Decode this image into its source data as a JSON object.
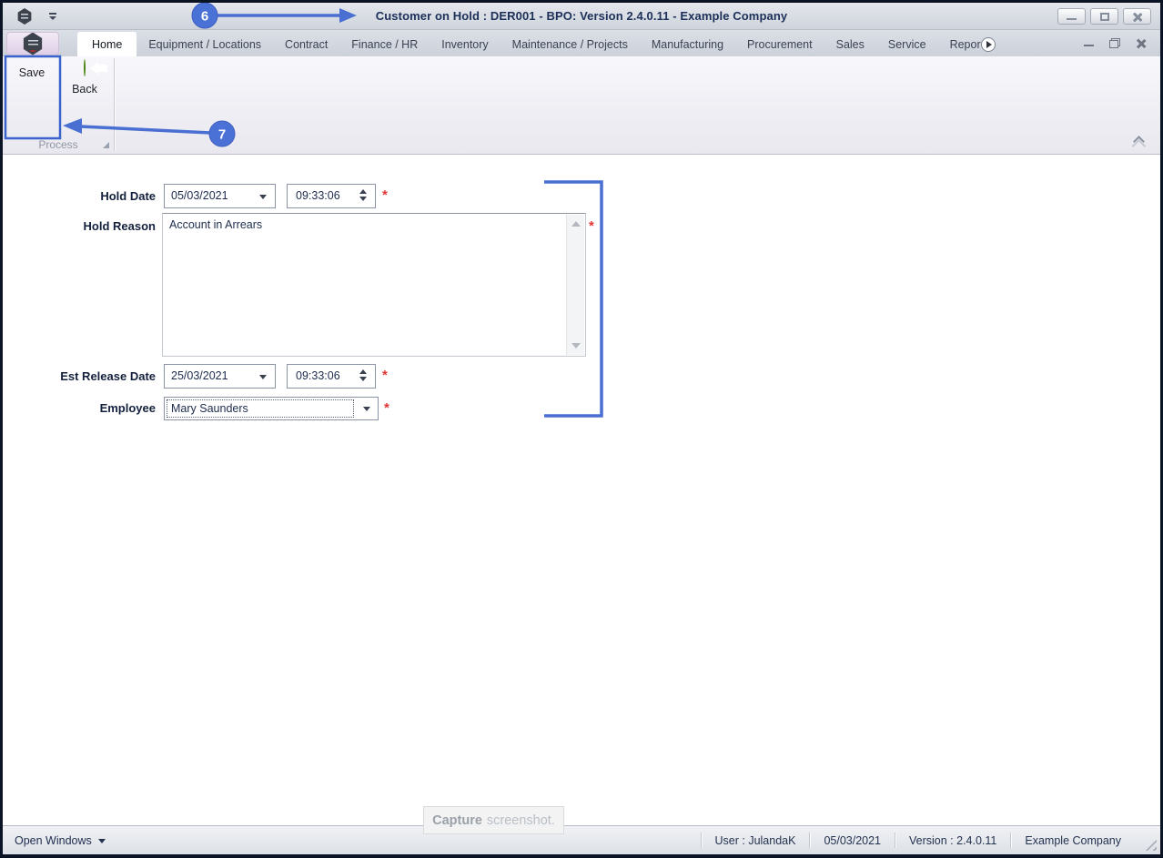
{
  "titlebar": {
    "title": "Customer on Hold : DER001 - BPO: Version 2.4.0.11 - Example Company"
  },
  "ribbon": {
    "tabs": [
      {
        "label": "Home",
        "active": true
      },
      {
        "label": "Equipment / Locations"
      },
      {
        "label": "Contract"
      },
      {
        "label": "Finance / HR"
      },
      {
        "label": "Inventory"
      },
      {
        "label": "Maintenance / Projects"
      },
      {
        "label": "Manufacturing"
      },
      {
        "label": "Procurement"
      },
      {
        "label": "Sales"
      },
      {
        "label": "Service"
      },
      {
        "label": "Repor"
      }
    ],
    "save_label": "Save",
    "back_label": "Back",
    "group_label": "Process"
  },
  "form": {
    "hold_date": {
      "label": "Hold Date",
      "date": "05/03/2021",
      "time": "09:33:06",
      "required": "*"
    },
    "hold_reason": {
      "label": "Hold Reason",
      "value": "Account in Arrears",
      "required": "*"
    },
    "est_release_date": {
      "label": "Est Release Date",
      "date": "25/03/2021",
      "time": "09:33:06",
      "required": "*"
    },
    "employee": {
      "label": "Employee",
      "value": "Mary Saunders",
      "required": "*"
    }
  },
  "annotations": {
    "step_6": "6",
    "step_7": "7"
  },
  "capture_overlay": {
    "bold": "Capture",
    "rest": "screenshot."
  },
  "statusbar": {
    "open_windows": "Open Windows",
    "cells": [
      "User : JulandaK",
      "05/03/2021",
      "Version : 2.4.0.11",
      "Example Company"
    ]
  },
  "colors": {
    "annotation_blue": "#4a6fd2",
    "required_red": "#e03535",
    "title_text": "#1c2f58",
    "save_icon_navy": "#1d2c52",
    "back_icon_green": "#8cc63f"
  },
  "icons": {
    "app_logo": "hexagon",
    "qat_dropdown": "bar+triangle-down",
    "minimize": "bar",
    "maximize": "square",
    "close": "x-cross",
    "ribbon_scroll_right": "triangle-right-in-circle",
    "ribbon_collapse": "chevron-up",
    "save": "floppy-disk",
    "back": "arrow-left-in-green-circle",
    "dropdown_arrow": "triangle-down",
    "spin_up": "triangle-up",
    "spin_down": "triangle-down",
    "scroll_up": "triangle-up",
    "scroll_down": "triangle-down",
    "dialog_launcher": "corner-triangle",
    "open_windows_dropdown": "triangle-down",
    "resize_grip": "diagonal-lines"
  }
}
